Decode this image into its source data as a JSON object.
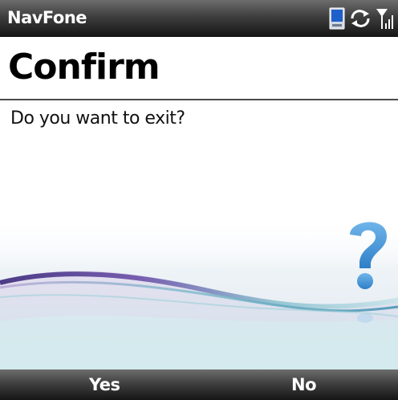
{
  "titlebar": {
    "app_name": "NavFone",
    "status_icons": [
      "device-icon",
      "sync-icon",
      "signal-icon"
    ]
  },
  "dialog": {
    "title": "Confirm",
    "message": "Do you want to exit?",
    "decoration_icon": "question-mark-icon"
  },
  "softkeys": {
    "left_label": "Yes",
    "right_label": "No"
  },
  "colors": {
    "bar_dark": "#151515",
    "bar_light": "#6c6c6c",
    "question_blue": "#3d8fd6",
    "wave_purple": "#5e3e96",
    "wave_teal": "#6fb3c1"
  }
}
